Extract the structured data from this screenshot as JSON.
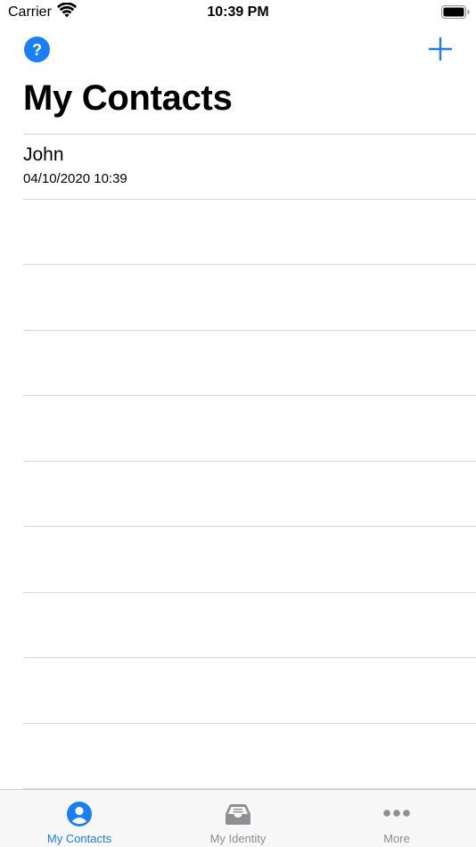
{
  "status_bar": {
    "carrier": "Carrier",
    "time": "10:39 PM",
    "icons": [
      "wifi-icon",
      "battery-icon"
    ]
  },
  "nav": {
    "help_icon": "question-mark-icon",
    "help_label": "?",
    "add_icon": "plus-icon",
    "title": "My Contacts"
  },
  "contacts": [
    {
      "name": "John",
      "date": "04/10/2020 10:39"
    }
  ],
  "tab_bar": {
    "tabs": [
      {
        "label": "My Contacts",
        "icon": "person-circle-icon",
        "selected": true
      },
      {
        "label": "My Identity",
        "icon": "tray-icon",
        "selected": false
      },
      {
        "label": "More",
        "icon": "ellipsis-icon",
        "selected": false
      }
    ]
  },
  "colors": {
    "accent": "#1a7ff5",
    "tab_inactive": "#8e8e93",
    "separator": "#d6d6da",
    "tab_bar_bg": "#f7f7f7"
  }
}
